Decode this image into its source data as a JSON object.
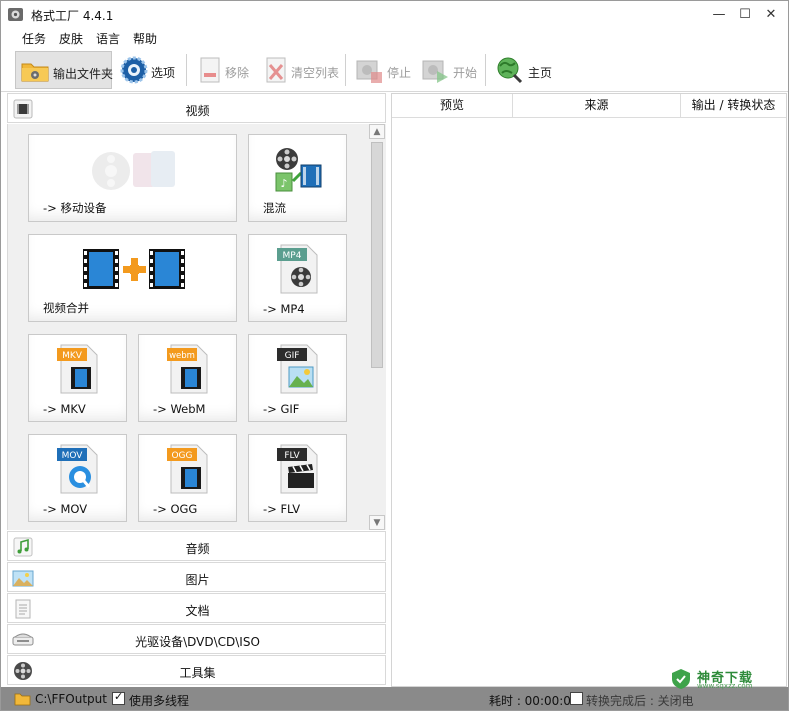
{
  "window": {
    "title": "格式工厂 4.4.1",
    "controls": {
      "minimize": "—",
      "maximize": "☐",
      "close": "✕"
    }
  },
  "menu": [
    "任务",
    "皮肤",
    "语言",
    "帮助"
  ],
  "toolbar": {
    "output_folder": "输出文件夹",
    "options": "选项",
    "remove": "移除",
    "clear_list": "清空列表",
    "stop": "停止",
    "start": "开始",
    "home": "主页"
  },
  "categories": {
    "video": "视频",
    "audio": "音频",
    "picture": "图片",
    "document": "文档",
    "disc": "光驱设备\\DVD\\CD\\ISO",
    "tools": "工具集"
  },
  "tiles": {
    "mobile": "-> 移动设备",
    "mux": "混流",
    "merge": "视频合并",
    "mp4": "-> MP4",
    "mkv": "-> MKV",
    "webm": "-> WebM",
    "gif": "-> GIF",
    "mov": "-> MOV",
    "ogg": "-> OGG",
    "flv": "-> FLV"
  },
  "file_badges": {
    "mp4": "MP4",
    "mkv": "MKV",
    "webm": "webm",
    "gif": "GIF",
    "mov": "MOV",
    "ogg": "OGG",
    "flv": "FLV"
  },
  "table": {
    "columns": [
      "预览",
      "来源",
      "输出 / 转换状态"
    ]
  },
  "status": {
    "output_path": "C:\\FFOutput",
    "multithread_label": "使用多线程",
    "multithread_checked": true,
    "elapsed_label": "耗时 : 00:00:00",
    "after_convert_label": "转换完成后 : 关闭电"
  },
  "watermark": {
    "name": "神奇下载",
    "url": "www.sqxzz.com"
  },
  "colors": {
    "statusbar": "#8a8a8a",
    "accent_orange": "#f39a1e",
    "film_blue": "#1f6fb8",
    "watermark_green": "#2e8b3a"
  }
}
